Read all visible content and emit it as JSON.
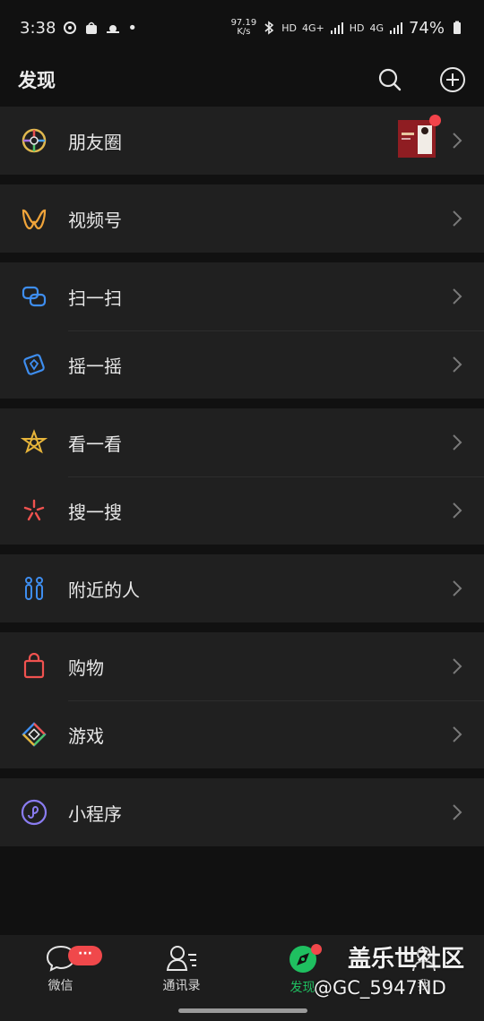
{
  "status": {
    "time": "3:38",
    "speed_top": "97.19",
    "speed_bottom": "K/s",
    "hd1": "HD",
    "net1": "4G+",
    "hd2": "HD",
    "net2": "4G",
    "battery": "74%"
  },
  "header": {
    "title": "发现"
  },
  "groups": [
    {
      "items": [
        {
          "label": "朋友圈",
          "icon": "moments-icon"
        }
      ]
    },
    {
      "items": [
        {
          "label": "视频号",
          "icon": "channels-icon"
        }
      ]
    },
    {
      "items": [
        {
          "label": "扫一扫",
          "icon": "scan-icon"
        },
        {
          "label": "摇一摇",
          "icon": "shake-icon"
        }
      ]
    },
    {
      "items": [
        {
          "label": "看一看",
          "icon": "top-stories-icon"
        },
        {
          "label": "搜一搜",
          "icon": "search-star-icon"
        }
      ]
    },
    {
      "items": [
        {
          "label": "附近的人",
          "icon": "people-nearby-icon"
        }
      ]
    },
    {
      "items": [
        {
          "label": "购物",
          "icon": "shopping-bag-icon"
        },
        {
          "label": "游戏",
          "icon": "games-icon"
        }
      ]
    },
    {
      "items": [
        {
          "label": "小程序",
          "icon": "mini-programs-icon"
        }
      ]
    }
  ],
  "tabbar": {
    "tabs": [
      {
        "label": "微信",
        "badge": "···"
      },
      {
        "label": "通讯录"
      },
      {
        "label": "发现"
      },
      {
        "label": "我"
      }
    ]
  },
  "watermark": {
    "line1": "盖乐世社区",
    "line2": "@GC_5947ND"
  },
  "colors": {
    "accent": "#1fbf60",
    "badge": "#f0484b",
    "background": "#111111",
    "row_bg": "#202020"
  }
}
